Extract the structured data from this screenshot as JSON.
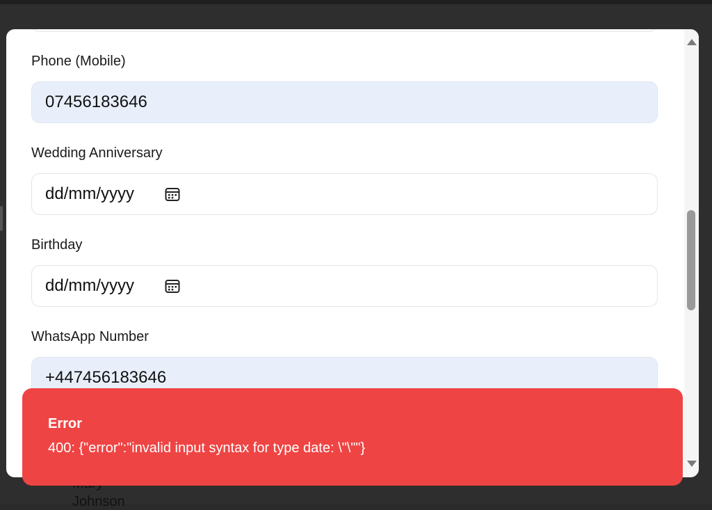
{
  "background": {
    "name_line1": "Mary",
    "name_line2": "Johnson"
  },
  "form": {
    "phone_mobile": {
      "label": "Phone (Mobile)",
      "value": "07456183646"
    },
    "wedding_anniversary": {
      "label": "Wedding Anniversary",
      "value": "dd/mm/yyyy",
      "icon": "calendar-icon"
    },
    "birthday": {
      "label": "Birthday",
      "value": "dd/mm/yyyy",
      "icon": "calendar-icon"
    },
    "whatsapp": {
      "label": "WhatsApp Number",
      "value": "+447456183646"
    }
  },
  "toast": {
    "title": "Error",
    "message": "400: {\"error\":\"invalid input syntax for type date: \\\"\\\"\"}",
    "color": "#ef4444"
  },
  "colors": {
    "filled_input_bg": "#e8effb",
    "backdrop": "#2e2e2e"
  }
}
